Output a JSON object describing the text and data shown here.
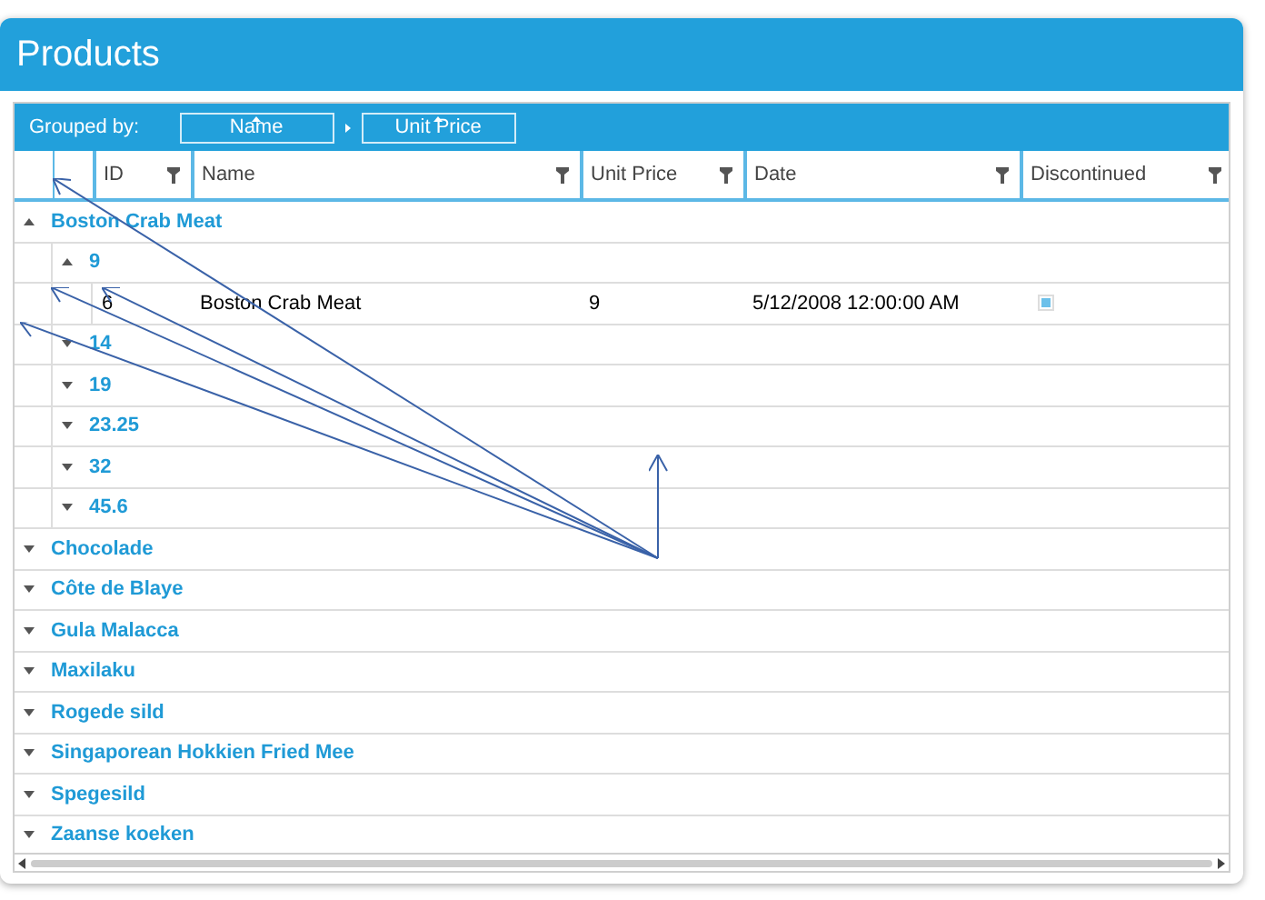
{
  "window": {
    "title": "Products"
  },
  "group_panel": {
    "label": "Grouped by:",
    "groups": [
      {
        "label": "Name",
        "sorted": true
      },
      {
        "label": "Unit Price",
        "sorted": true
      }
    ]
  },
  "columns": [
    {
      "label": "ID",
      "filter": true
    },
    {
      "label": "Name",
      "filter": true
    },
    {
      "label": "Unit Price",
      "filter": true
    },
    {
      "label": "Date",
      "filter": true
    },
    {
      "label": "Discontinued",
      "filter": true
    }
  ],
  "groups": [
    {
      "label": "Boston Crab Meat",
      "expanded": true,
      "children": [
        {
          "label": "9",
          "expanded": true,
          "rows": [
            {
              "id": "6",
              "name": "Boston Crab Meat",
              "unit_price": "9",
              "date": "5/12/2008 12:00:00 AM",
              "discontinued": true
            }
          ]
        },
        {
          "label": "14",
          "expanded": false
        },
        {
          "label": "19",
          "expanded": false
        },
        {
          "label": "23.25",
          "expanded": false
        },
        {
          "label": "32",
          "expanded": false
        },
        {
          "label": "45.6",
          "expanded": false
        }
      ]
    },
    {
      "label": "Chocolade",
      "expanded": false
    },
    {
      "label": "Côte de Blaye",
      "expanded": false
    },
    {
      "label": "Gula Malacca",
      "expanded": false
    },
    {
      "label": "Maxilaku",
      "expanded": false
    },
    {
      "label": "Rogede sild",
      "expanded": false
    },
    {
      "label": "Singaporean Hokkien Fried Mee",
      "expanded": false
    },
    {
      "label": "Spegesild",
      "expanded": false
    },
    {
      "label": "Zaanse koeken",
      "expanded": false
    }
  ]
}
